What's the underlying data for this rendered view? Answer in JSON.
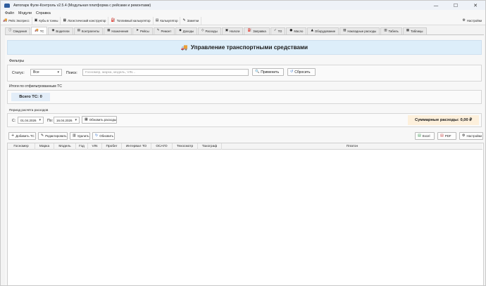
{
  "window": {
    "title": "Автопарк Фуле-Контроль v2.5.4 (Модульная платформа с рейсами и ремонтами)",
    "minimize": "—",
    "maximize": "☐",
    "close": "✕"
  },
  "menu": [
    "Файл",
    "Модули",
    "Справка"
  ],
  "toolbar": {
    "items": [
      {
        "icon": "truck-icon",
        "glyph": "🚚",
        "label": "Рейс Экспресс"
      },
      {
        "icon": "cube-icon",
        "glyph": "▣",
        "label": "Кубы в тонны"
      },
      {
        "icon": "box-icon",
        "glyph": "▦",
        "label": "Логистический конструктор"
      },
      {
        "icon": "fuel-icon",
        "glyph": "⛽",
        "label": "Топливный калькулятор"
      },
      {
        "icon": "calculator-icon",
        "glyph": "▤",
        "label": "Калькулятор"
      },
      {
        "icon": "note-icon",
        "glyph": "✎",
        "label": "Заметки"
      }
    ],
    "settings": {
      "icon": "gear-icon",
      "glyph": "⚙",
      "label": "Настройки"
    }
  },
  "tabs": [
    {
      "icon": "info-icon",
      "glyph": "ⓘ",
      "label": "Сведения",
      "active": false
    },
    {
      "icon": "truck-icon",
      "glyph": "🚚",
      "label": "ТС",
      "active": true
    },
    {
      "icon": "driver-icon",
      "glyph": "◉",
      "label": "Водители",
      "active": false
    },
    {
      "icon": "contract-icon",
      "glyph": "▤",
      "label": "Контрагенты",
      "active": false
    },
    {
      "icon": "assign-icon",
      "glyph": "▦",
      "label": "Назначения",
      "active": false
    },
    {
      "icon": "route-icon",
      "glyph": "➤",
      "label": "Рейсы",
      "active": false
    },
    {
      "icon": "wrench-icon",
      "glyph": "✎",
      "label": "Ремонт",
      "active": false
    },
    {
      "icon": "income-icon",
      "glyph": "◆",
      "label": "Доходы",
      "active": false
    },
    {
      "icon": "expense-icon",
      "glyph": "◇",
      "label": "Расходы",
      "active": false
    },
    {
      "icon": "tax-icon",
      "glyph": "▣",
      "label": "Налоги",
      "active": false
    },
    {
      "icon": "fuel-icon",
      "glyph": "⛽",
      "label": "Заправка",
      "active": false
    },
    {
      "icon": "tool-icon",
      "glyph": "✓",
      "label": "ТО",
      "active": false
    },
    {
      "icon": "oil-icon",
      "glyph": "●",
      "label": "Масло",
      "active": false
    },
    {
      "icon": "equipment-icon",
      "glyph": "▲",
      "label": "Оборудование",
      "active": false
    },
    {
      "icon": "overhead-icon",
      "glyph": "▧",
      "label": "Накладные расходы",
      "active": false
    },
    {
      "icon": "table-icon",
      "glyph": "▥",
      "label": "Табель",
      "active": false
    },
    {
      "icon": "tables-icon",
      "glyph": "▦",
      "label": "Таблицы",
      "active": false
    }
  ],
  "banner": {
    "icon": "truck-icon",
    "glyph": "🚚",
    "title": "Управление транспортными средствами"
  },
  "filters": {
    "section_label": "Фильтры",
    "status_label": "Статус:",
    "status_value": "Все",
    "search_label": "Поиск:",
    "search_placeholder": "Госномер, марка, модель, VIN...",
    "apply_label": "Применить",
    "reset_label": "Сбросить"
  },
  "totals": {
    "section_label": "Итоги по отфильтрованным ТС",
    "total_vehicles": "Всего ТС: 0"
  },
  "period": {
    "section_label": "Период расчёта расходов",
    "from_label": "С:",
    "from_value": "01.04.2026",
    "to_label": "По:",
    "to_value": "16.04.2026",
    "update_label": "Обновить расходы",
    "total_expenses": "Суммарные расходы: 0,00 ₽"
  },
  "actions": {
    "add_label": "Добавить ТС",
    "edit_label": "Редактировать",
    "delete_label": "Удалить",
    "refresh_label": "Обновить",
    "excel_label": "Excel",
    "pdf_label": "PDF",
    "settings_label": "Настройки"
  },
  "table": {
    "columns": [
      "Госномер",
      "Марка",
      "Модель",
      "Год",
      "VIN",
      "Пробег",
      "Интервал ТО",
      "ОСАГО",
      "Техосмотр",
      "Тахограф",
      "Платон"
    ],
    "rows": []
  },
  "colors": {
    "banner_bg": "#ddeefa",
    "total_pill_bg": "#e2edf8",
    "sum_pill_bg": "#fdf0dc"
  }
}
